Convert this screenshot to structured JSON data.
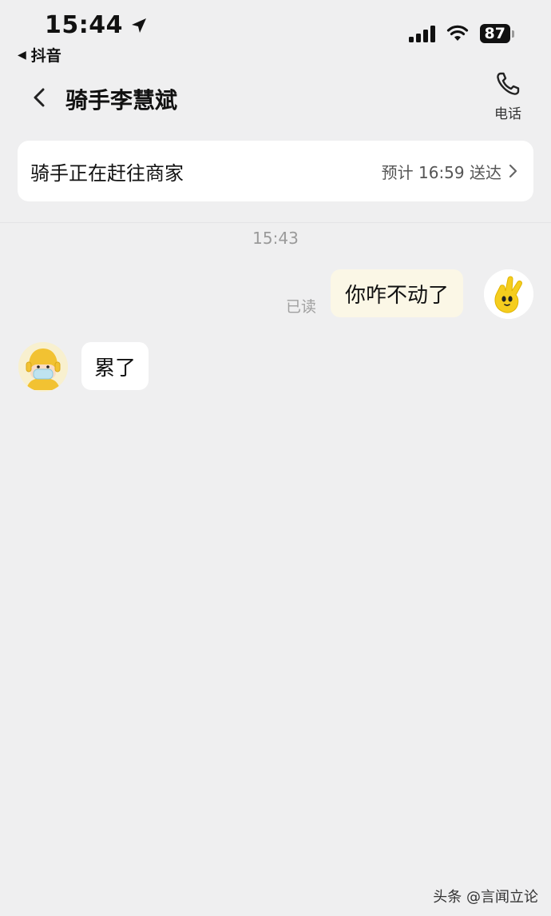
{
  "status_bar": {
    "time": "15:44",
    "back_app": "抖音",
    "battery": "87"
  },
  "nav": {
    "title": "骑手李慧斌",
    "phone_label": "电话"
  },
  "order_card": {
    "status": "骑手正在赶往商家",
    "eta": "预计 16:59 送达"
  },
  "chat": {
    "timestamp": "15:43",
    "messages": [
      {
        "from": "me",
        "text": "你咋不动了",
        "read_label": "已读"
      },
      {
        "from": "rider",
        "text": "累了"
      }
    ]
  },
  "watermark": "头条 @言闻立论",
  "colors": {
    "background": "#efeff0",
    "outgoing_bubble": "#fbf7e6",
    "incoming_bubble": "#ffffff",
    "avatar_yellow": "#f5cd1e"
  }
}
